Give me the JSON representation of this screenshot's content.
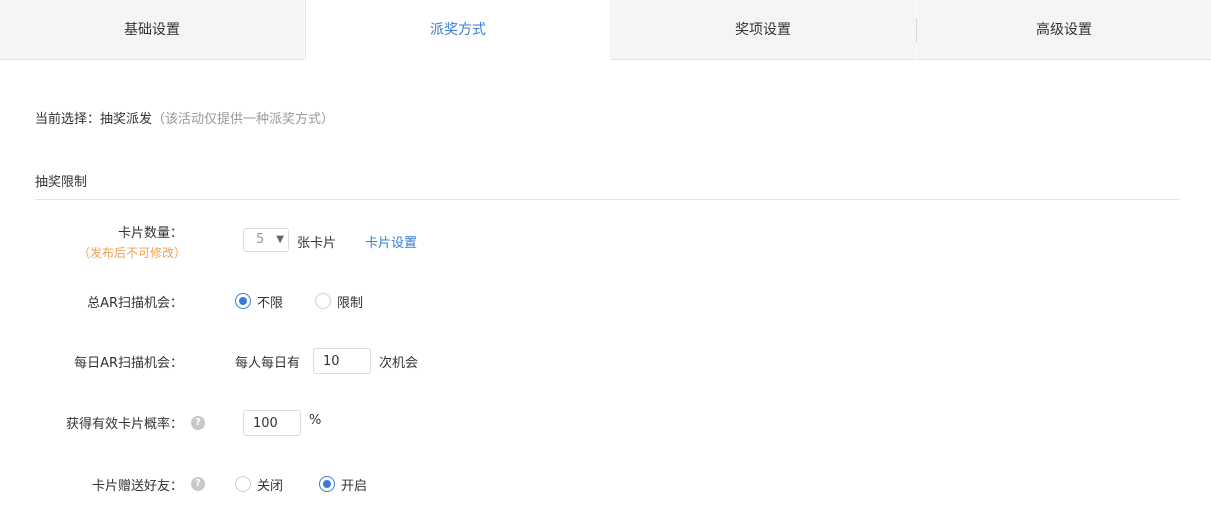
{
  "tabs": [
    {
      "label": "基础设置",
      "active": false
    },
    {
      "label": "派奖方式",
      "active": true
    },
    {
      "label": "奖项设置",
      "active": false
    },
    {
      "label": "高级设置",
      "active": false
    }
  ],
  "current": {
    "prefix": "当前选择：",
    "value": "抽奖派发",
    "note": "（该活动仅提供一种派奖方式）"
  },
  "section_title": "抽奖限制",
  "card_count": {
    "label": "卡片数量：",
    "hint": "（发布后不可修改）",
    "selected": "5",
    "unit": "张卡片",
    "link": "卡片设置"
  },
  "total_ar": {
    "label": "总AR扫描机会：",
    "options": [
      {
        "label": "不限",
        "checked": true
      },
      {
        "label": "限制",
        "checked": false
      }
    ]
  },
  "daily_ar": {
    "label": "每日AR扫描机会：",
    "prefix": "每人每日有",
    "value": "10",
    "suffix": "次机会"
  },
  "valid_rate": {
    "label": "获得有效卡片概率：",
    "help_icon": "question-circle-icon",
    "value": "100",
    "unit": "%"
  },
  "gift_card": {
    "label": "卡片赠送好友：",
    "help_icon": "question-circle-icon",
    "options": [
      {
        "label": "关闭",
        "checked": false
      },
      {
        "label": "开启",
        "checked": true
      }
    ]
  },
  "colors": {
    "accent": "#3a7bd5",
    "hint": "#f0a050",
    "muted": "#999999"
  }
}
